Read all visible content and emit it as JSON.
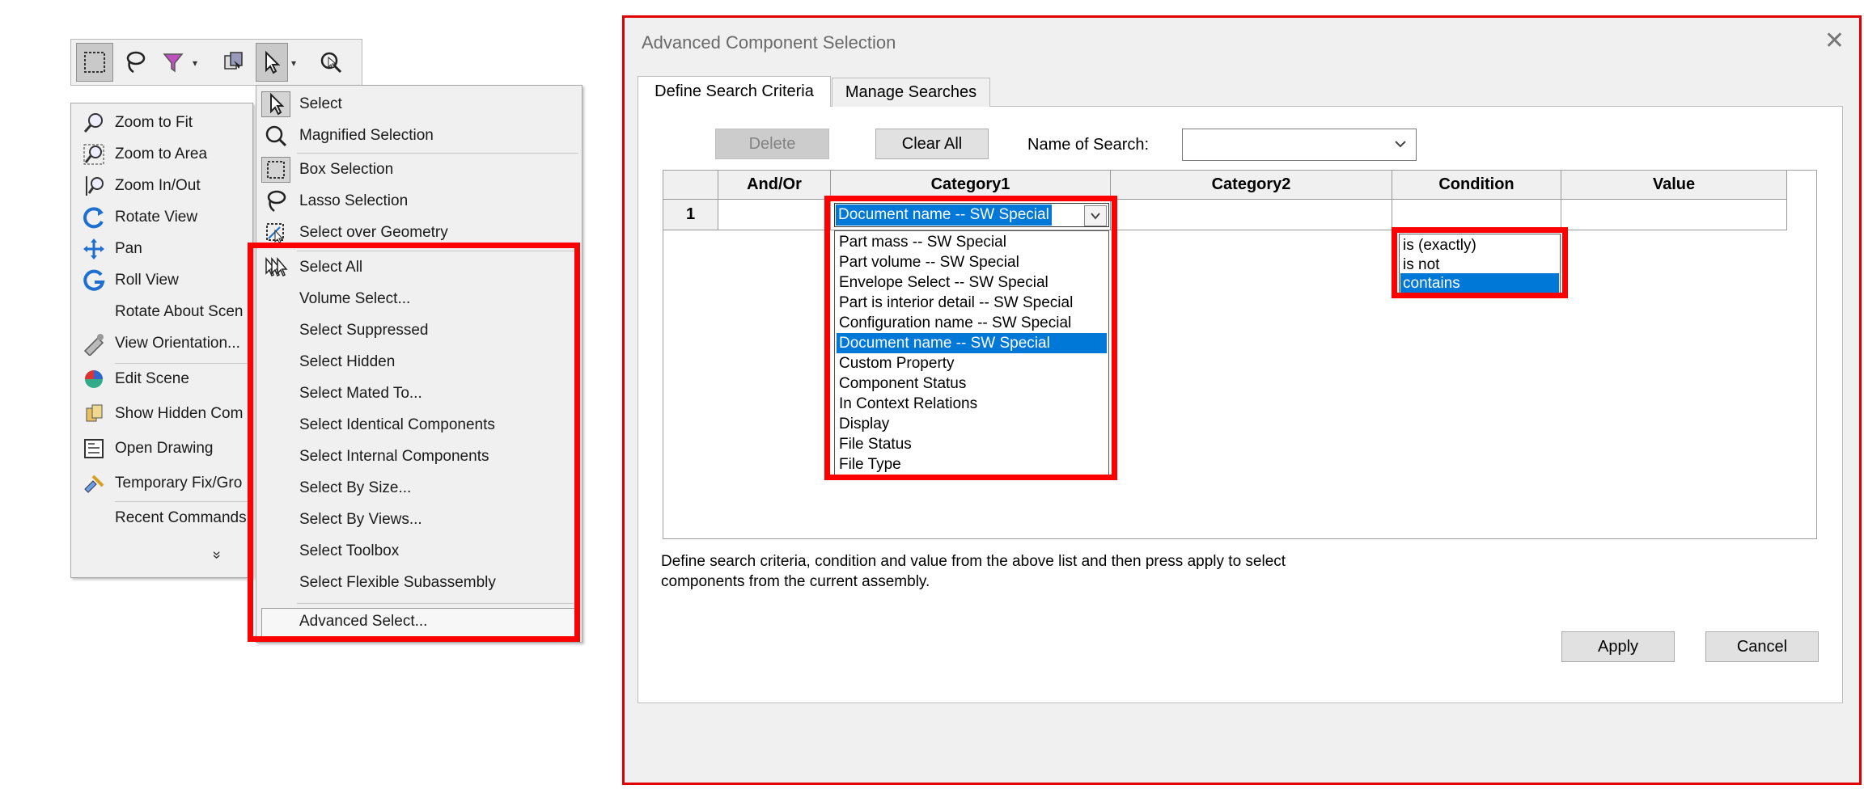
{
  "toolbar": {
    "buttons": [
      "box-selection",
      "lasso",
      "filter",
      "select-mode",
      "select",
      "magnified-selection"
    ]
  },
  "context_menu": {
    "items": [
      {
        "label": "Zoom to Fit",
        "icon": "zoom-fit-icon"
      },
      {
        "label": "Zoom to Area",
        "icon": "zoom-area-icon"
      },
      {
        "label": "Zoom In/Out",
        "icon": "zoom-in-out-icon"
      },
      {
        "label": "Rotate View",
        "icon": "rotate-icon"
      },
      {
        "label": "Pan",
        "icon": "pan-icon"
      },
      {
        "label": "Roll View",
        "icon": "roll-icon"
      },
      {
        "label": "Rotate About Scen",
        "icon": ""
      },
      {
        "label": "View Orientation...",
        "icon": "view-orientation-icon"
      },
      {
        "label": "Edit Scene",
        "icon": "edit-scene-icon"
      },
      {
        "label": "Show Hidden Com",
        "icon": "show-hidden-icon"
      },
      {
        "label": "Open Drawing",
        "icon": "open-drawing-icon"
      },
      {
        "label": "Temporary Fix/Gro",
        "icon": "temporary-fix-icon"
      },
      {
        "label": "Recent Commands",
        "icon": ""
      }
    ],
    "more": "»"
  },
  "selection_menu": {
    "items": [
      {
        "label": "Select",
        "icon": "select-arrow-icon"
      },
      {
        "label": "Magnified Selection",
        "icon": "magnified-selection-icon"
      },
      {
        "label": "Box Selection",
        "icon": "box-selection-icon"
      },
      {
        "label": "Lasso Selection",
        "icon": "lasso-icon"
      },
      {
        "label": "Select over Geometry",
        "icon": "select-geometry-icon"
      },
      {
        "label": "Select All",
        "icon": "select-all-icon"
      },
      {
        "label": "Volume Select...",
        "icon": ""
      },
      {
        "label": "Select Suppressed",
        "icon": ""
      },
      {
        "label": "Select Hidden",
        "icon": ""
      },
      {
        "label": "Select Mated To...",
        "icon": ""
      },
      {
        "label": "Select Identical Components",
        "icon": ""
      },
      {
        "label": "Select Internal Components",
        "icon": ""
      },
      {
        "label": "Select By Size...",
        "icon": ""
      },
      {
        "label": "Select By Views...",
        "icon": ""
      },
      {
        "label": "Select Toolbox",
        "icon": ""
      },
      {
        "label": "Select Flexible Subassembly",
        "icon": ""
      },
      {
        "label": "Advanced Select...",
        "icon": ""
      }
    ]
  },
  "dialog": {
    "title": "Advanced Component Selection",
    "close": "✕",
    "tabs": [
      "Define Search Criteria",
      "Manage Searches"
    ],
    "delete_label": "Delete",
    "clear_all_label": "Clear All",
    "name_of_search_label": "Name of Search:",
    "name_of_search_value": "",
    "columns": [
      "And/Or",
      "Category1",
      "Category2",
      "Condition",
      "Value"
    ],
    "row_number": "1",
    "category1_selected": "Document name -- SW Special",
    "category1_options": [
      "Part mass -- SW Special",
      "Part volume -- SW Special",
      "Envelope Select -- SW Special",
      "Part is interior detail -- SW Special",
      "Configuration name -- SW Special",
      "Document name -- SW Special",
      "Custom Property",
      "Component Status",
      "In Context Relations",
      "Display",
      "File Status",
      "File Type"
    ],
    "category1_options_selected_index": 5,
    "condition_options": [
      "is (exactly)",
      "is not",
      "contains"
    ],
    "condition_selected_index": 2,
    "hint_line1": "Define search criteria, condition and value from the above list and then press apply to select",
    "hint_line2": "components from the current assembly.",
    "apply_label": "Apply",
    "cancel_label": "Cancel"
  },
  "colors": {
    "highlight": "#ff0000",
    "selection": "#0078d7"
  }
}
